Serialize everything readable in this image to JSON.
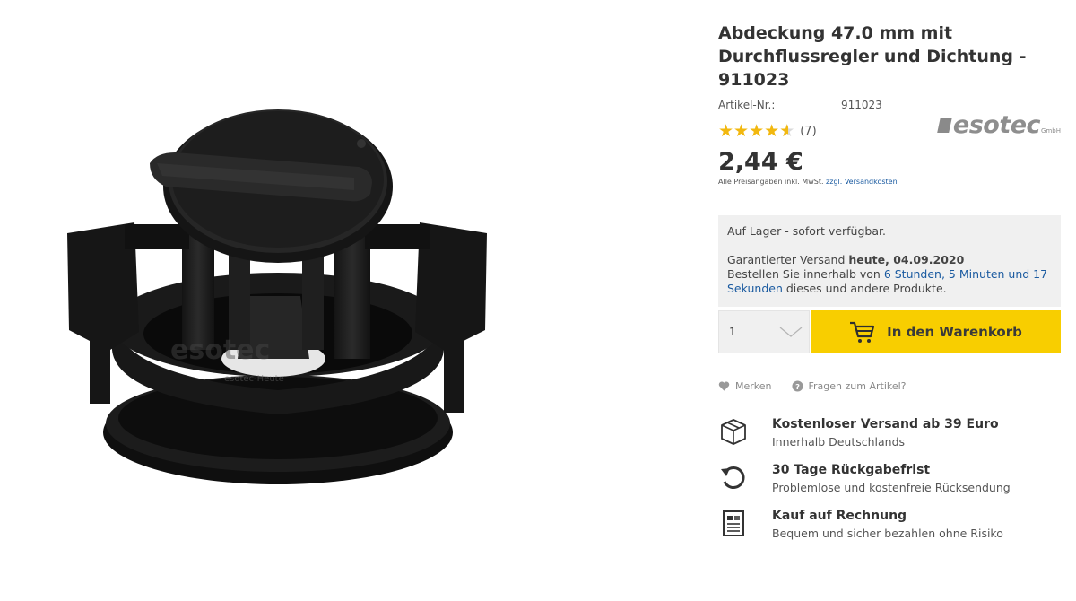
{
  "product": {
    "title": "Abdeckung 47.0 mm mit Durchflussregler und Dichtung - 911023",
    "article_label": "Artikel-Nr.:",
    "article_number": "911023",
    "rating": 4.5,
    "rating_count": "(7)",
    "brand": {
      "word": "esotec",
      "suffix": "GmbH"
    },
    "price": "2,44 €",
    "tax_note": "Alle Preisangaben inkl. MwSt.",
    "shipping_link": "zzgl. Versandkosten",
    "image_watermark": "esotec-Heute"
  },
  "delivery": {
    "stock": "Auf Lager - sofort verfügbar.",
    "guaranteed_prefix": "Garantierter Versand ",
    "guaranteed_date": "heute, 04.09.2020",
    "order_prefix": "Bestellen Sie innerhalb von ",
    "countdown": "6 Stunden, 5 Minuten und 17 Sekunden",
    "order_suffix": " dieses und andere Produkte."
  },
  "cart": {
    "quantity": "1",
    "button_label": "In den Warenkorb",
    "accent_color": "#f8ce00"
  },
  "actions": {
    "remember": "Merken",
    "question": "Fragen zum Artikel?"
  },
  "benefits": [
    {
      "icon": "box-icon",
      "title": "Kostenloser Versand ab 39 Euro",
      "subtitle": "Innerhalb Deutschlands"
    },
    {
      "icon": "return-icon",
      "title": "30 Tage Rückgabefrist",
      "subtitle": "Problemlose und kostenfreie Rücksendung"
    },
    {
      "icon": "invoice-icon",
      "title": "Kauf auf Rechnung",
      "subtitle": "Bequem und sicher bezahlen ohne Risiko"
    }
  ]
}
